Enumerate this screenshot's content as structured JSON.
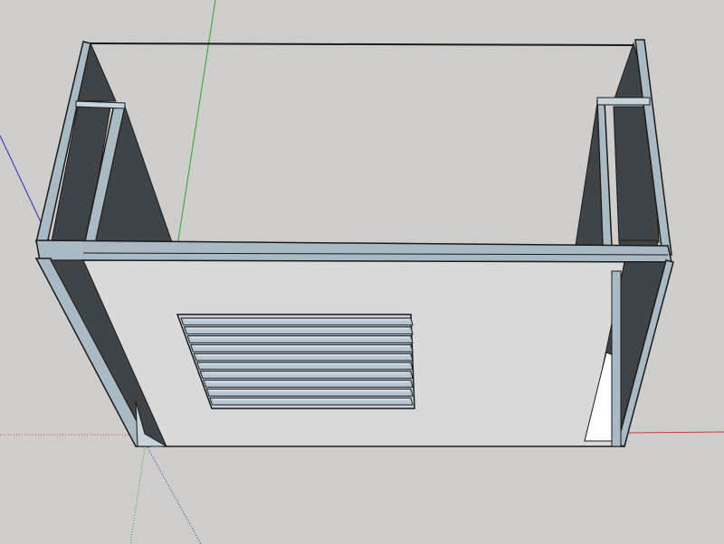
{
  "app": {
    "view": "3d-model-viewport",
    "background_color": "#cfcdcb"
  },
  "colors": {
    "edge": "#1a1a1a",
    "panel_face": "#d9d9d9",
    "shadow_face": "#3f4448",
    "frame_face": "#a9bac4",
    "frame_face_light": "#c7d4dc",
    "vent_slat": "#b7c7d1",
    "axis_red": "#d33b3b",
    "axis_green": "#2aa52a",
    "axis_blue": "#2b2bb8"
  },
  "axes": {
    "red": "x-axis",
    "green": "y-axis",
    "blue": "z-axis"
  },
  "model": {
    "object": "open-box-with-vent",
    "vent_slat_count": 10
  }
}
